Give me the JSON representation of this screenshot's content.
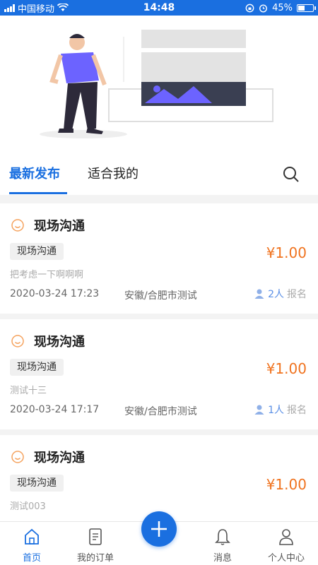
{
  "status_bar": {
    "carrier": "中国移动",
    "time": "14:48",
    "battery": "45%",
    "battery_level": 0.45
  },
  "tabs": {
    "latest": "最新发布",
    "suitable": "适合我的"
  },
  "orders": [
    {
      "title": "现场沟通",
      "tag": "现场沟通",
      "price": "¥1.00",
      "desc": "把考虑一下啊啊啊",
      "date": "2020-03-24 17:23",
      "location": "安徽/合肥市测试",
      "count": "2人",
      "signup_label": "报名"
    },
    {
      "title": "现场沟通",
      "tag": "现场沟通",
      "price": "¥1.00",
      "desc": "测试十三",
      "date": "2020-03-24 17:17",
      "location": "安徽/合肥市测试",
      "count": "1人",
      "signup_label": "报名"
    },
    {
      "title": "现场沟通",
      "tag": "现场沟通",
      "price": "¥1.00",
      "desc": "测试003",
      "date": "",
      "location": "",
      "count": "",
      "signup_label": ""
    }
  ],
  "nav": {
    "home": "首页",
    "orders": "我的订单",
    "messages": "消息",
    "profile": "个人中心"
  },
  "colors": {
    "accent": "#1a6fe0",
    "price": "#f0731f",
    "illustration": "#6c63ff"
  }
}
